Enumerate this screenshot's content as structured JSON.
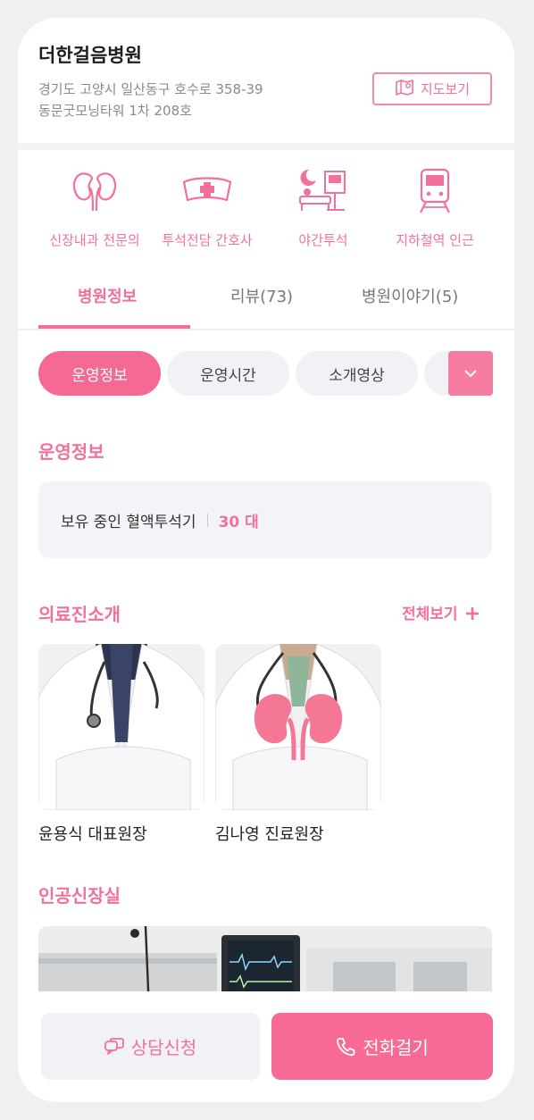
{
  "hospital": {
    "name": "더한걸음병원",
    "address_line1": "경기도 고양시 일산동구 호수로 358-39",
    "address_line2": "동문굿모닝타워 1차 208호",
    "map_label": "지도보기"
  },
  "features": [
    {
      "icon": "kidney-icon",
      "label": "신장내과 전문의"
    },
    {
      "icon": "nurse-cap-icon",
      "label": "투석전담 간호사"
    },
    {
      "icon": "night-dialysis-icon",
      "label": "야간투석"
    },
    {
      "icon": "subway-icon",
      "label": "지하철역 인근"
    }
  ],
  "tabs": [
    {
      "label": "병원정보",
      "active": true
    },
    {
      "label": "리뷰(73)",
      "active": false
    },
    {
      "label": "병원이야기(5)",
      "active": false
    }
  ],
  "chips": [
    {
      "label": "운영정보",
      "active": true
    },
    {
      "label": "운영시간",
      "active": false
    },
    {
      "label": "소개영상",
      "active": false
    }
  ],
  "operation": {
    "title": "운영정보",
    "label": "보유 중인 혈액투석기",
    "value": "30 대"
  },
  "doctors": {
    "title": "의료진소개",
    "view_all": "전체보기",
    "list": [
      {
        "name": "윤용식 대표원장"
      },
      {
        "name": "김나영 진료원장"
      }
    ]
  },
  "dialysis_room": {
    "title": "인공신장실"
  },
  "actions": {
    "consult": "상담신청",
    "call": "전화걸기"
  },
  "colors": {
    "accent": "#f2709a",
    "accent_fill": "#f66a95",
    "chip_bg": "#f1f2f6"
  }
}
